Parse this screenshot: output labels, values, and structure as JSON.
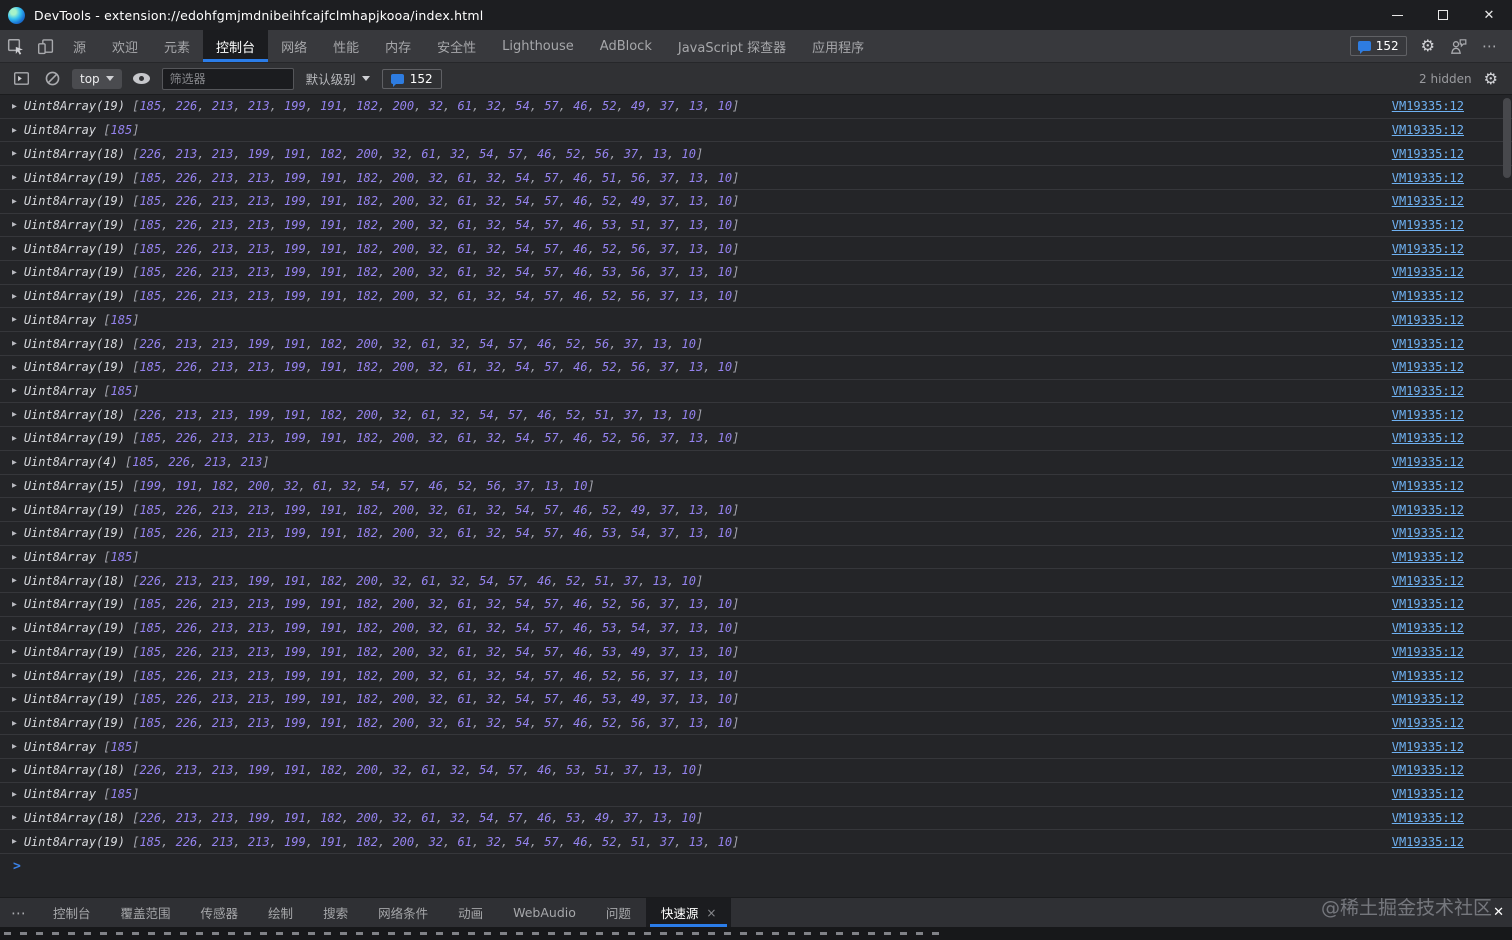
{
  "window": {
    "title": "DevTools - extension://edohfgmjmdnibeihfcajfclmhapjkooa/index.html"
  },
  "icons": {
    "more": "⋯",
    "gear": "⚙",
    "close": "✕",
    "tab_close": "×",
    "expand_arrow": "▶",
    "dropdown_arrow": "▼"
  },
  "tabbar": {
    "tabs": [
      {
        "label": "源"
      },
      {
        "label": "欢迎"
      },
      {
        "label": "元素"
      },
      {
        "label": "控制台"
      },
      {
        "label": "网络"
      },
      {
        "label": "性能"
      },
      {
        "label": "内存"
      },
      {
        "label": "安全性"
      },
      {
        "label": "Lighthouse"
      },
      {
        "label": "AdBlock"
      },
      {
        "label": "JavaScript 探查器"
      },
      {
        "label": "应用程序"
      }
    ],
    "active_index": 3,
    "badge_count": "152"
  },
  "toolbar": {
    "context": "top",
    "filter_placeholder": "筛选器",
    "level_label": "默认级别",
    "message_count": "152",
    "hidden_label": "2 hidden"
  },
  "console": {
    "prompt": ">",
    "rows": [
      {
        "label": "Uint8Array(19)",
        "values": "[185, 226, 213, 213, 199, 191, 182, 200, 32, 61, 32, 54, 57, 46, 52, 49, 37, 13, 10]",
        "link": "VM19335:12"
      },
      {
        "label": "Uint8Array",
        "values": "[185]",
        "link": "VM19335:12"
      },
      {
        "label": "Uint8Array(18)",
        "values": "[226, 213, 213, 199, 191, 182, 200, 32, 61, 32, 54, 57, 46, 52, 56, 37, 13, 10]",
        "link": "VM19335:12"
      },
      {
        "label": "Uint8Array(19)",
        "values": "[185, 226, 213, 213, 199, 191, 182, 200, 32, 61, 32, 54, 57, 46, 51, 56, 37, 13, 10]",
        "link": "VM19335:12"
      },
      {
        "label": "Uint8Array(19)",
        "values": "[185, 226, 213, 213, 199, 191, 182, 200, 32, 61, 32, 54, 57, 46, 52, 49, 37, 13, 10]",
        "link": "VM19335:12"
      },
      {
        "label": "Uint8Array(19)",
        "values": "[185, 226, 213, 213, 199, 191, 182, 200, 32, 61, 32, 54, 57, 46, 53, 51, 37, 13, 10]",
        "link": "VM19335:12"
      },
      {
        "label": "Uint8Array(19)",
        "values": "[185, 226, 213, 213, 199, 191, 182, 200, 32, 61, 32, 54, 57, 46, 52, 56, 37, 13, 10]",
        "link": "VM19335:12"
      },
      {
        "label": "Uint8Array(19)",
        "values": "[185, 226, 213, 213, 199, 191, 182, 200, 32, 61, 32, 54, 57, 46, 53, 56, 37, 13, 10]",
        "link": "VM19335:12"
      },
      {
        "label": "Uint8Array(19)",
        "values": "[185, 226, 213, 213, 199, 191, 182, 200, 32, 61, 32, 54, 57, 46, 52, 56, 37, 13, 10]",
        "link": "VM19335:12"
      },
      {
        "label": "Uint8Array",
        "values": "[185]",
        "link": "VM19335:12"
      },
      {
        "label": "Uint8Array(18)",
        "values": "[226, 213, 213, 199, 191, 182, 200, 32, 61, 32, 54, 57, 46, 52, 56, 37, 13, 10]",
        "link": "VM19335:12"
      },
      {
        "label": "Uint8Array(19)",
        "values": "[185, 226, 213, 213, 199, 191, 182, 200, 32, 61, 32, 54, 57, 46, 52, 56, 37, 13, 10]",
        "link": "VM19335:12"
      },
      {
        "label": "Uint8Array",
        "values": "[185]",
        "link": "VM19335:12"
      },
      {
        "label": "Uint8Array(18)",
        "values": "[226, 213, 213, 199, 191, 182, 200, 32, 61, 32, 54, 57, 46, 52, 51, 37, 13, 10]",
        "link": "VM19335:12"
      },
      {
        "label": "Uint8Array(19)",
        "values": "[185, 226, 213, 213, 199, 191, 182, 200, 32, 61, 32, 54, 57, 46, 52, 56, 37, 13, 10]",
        "link": "VM19335:12"
      },
      {
        "label": "Uint8Array(4)",
        "values": "[185, 226, 213, 213]",
        "link": "VM19335:12"
      },
      {
        "label": "Uint8Array(15)",
        "values": "[199, 191, 182, 200, 32, 61, 32, 54, 57, 46, 52, 56, 37, 13, 10]",
        "link": "VM19335:12"
      },
      {
        "label": "Uint8Array(19)",
        "values": "[185, 226, 213, 213, 199, 191, 182, 200, 32, 61, 32, 54, 57, 46, 52, 49, 37, 13, 10]",
        "link": "VM19335:12"
      },
      {
        "label": "Uint8Array(19)",
        "values": "[185, 226, 213, 213, 199, 191, 182, 200, 32, 61, 32, 54, 57, 46, 53, 54, 37, 13, 10]",
        "link": "VM19335:12"
      },
      {
        "label": "Uint8Array",
        "values": "[185]",
        "link": "VM19335:12"
      },
      {
        "label": "Uint8Array(18)",
        "values": "[226, 213, 213, 199, 191, 182, 200, 32, 61, 32, 54, 57, 46, 52, 51, 37, 13, 10]",
        "link": "VM19335:12"
      },
      {
        "label": "Uint8Array(19)",
        "values": "[185, 226, 213, 213, 199, 191, 182, 200, 32, 61, 32, 54, 57, 46, 52, 56, 37, 13, 10]",
        "link": "VM19335:12"
      },
      {
        "label": "Uint8Array(19)",
        "values": "[185, 226, 213, 213, 199, 191, 182, 200, 32, 61, 32, 54, 57, 46, 53, 54, 37, 13, 10]",
        "link": "VM19335:12"
      },
      {
        "label": "Uint8Array(19)",
        "values": "[185, 226, 213, 213, 199, 191, 182, 200, 32, 61, 32, 54, 57, 46, 53, 49, 37, 13, 10]",
        "link": "VM19335:12"
      },
      {
        "label": "Uint8Array(19)",
        "values": "[185, 226, 213, 213, 199, 191, 182, 200, 32, 61, 32, 54, 57, 46, 52, 56, 37, 13, 10]",
        "link": "VM19335:12"
      },
      {
        "label": "Uint8Array(19)",
        "values": "[185, 226, 213, 213, 199, 191, 182, 200, 32, 61, 32, 54, 57, 46, 53, 49, 37, 13, 10]",
        "link": "VM19335:12"
      },
      {
        "label": "Uint8Array(19)",
        "values": "[185, 226, 213, 213, 199, 191, 182, 200, 32, 61, 32, 54, 57, 46, 52, 56, 37, 13, 10]",
        "link": "VM19335:12"
      },
      {
        "label": "Uint8Array",
        "values": "[185]",
        "link": "VM19335:12"
      },
      {
        "label": "Uint8Array(18)",
        "values": "[226, 213, 213, 199, 191, 182, 200, 32, 61, 32, 54, 57, 46, 53, 51, 37, 13, 10]",
        "link": "VM19335:12"
      },
      {
        "label": "Uint8Array",
        "values": "[185]",
        "link": "VM19335:12"
      },
      {
        "label": "Uint8Array(18)",
        "values": "[226, 213, 213, 199, 191, 182, 200, 32, 61, 32, 54, 57, 46, 53, 49, 37, 13, 10]",
        "link": "VM19335:12"
      },
      {
        "label": "Uint8Array(19)",
        "values": "[185, 226, 213, 213, 199, 191, 182, 200, 32, 61, 32, 54, 57, 46, 52, 51, 37, 13, 10]",
        "link": "VM19335:12"
      }
    ]
  },
  "drawer": {
    "tabs": [
      "控制台",
      "覆盖范围",
      "传感器",
      "绘制",
      "搜索",
      "网络条件",
      "动画",
      "WebAudio",
      "问题",
      "快速源"
    ],
    "active_index": 9
  },
  "watermark": "@稀土掘金技术社区"
}
